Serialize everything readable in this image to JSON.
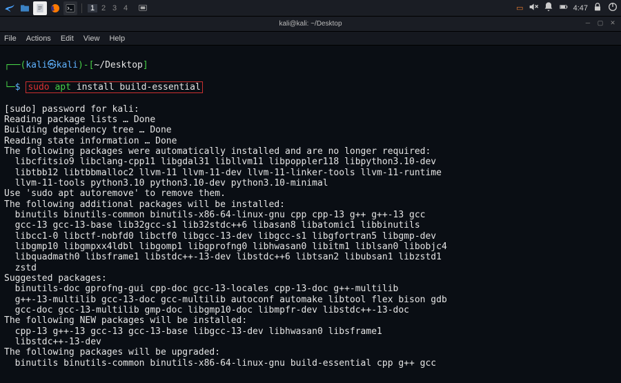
{
  "taskbar": {
    "workspaces": [
      "1",
      "2",
      "3",
      "4"
    ],
    "active_workspace": "1",
    "clock": "4:47"
  },
  "window": {
    "title": "kali@kali: ~/Desktop"
  },
  "menubar": {
    "file": "File",
    "actions": "Actions",
    "edit": "Edit",
    "view": "View",
    "help": "Help"
  },
  "prompt": {
    "open": "┌──(",
    "userhost": "kali㉿kali",
    "close_user": ")-[",
    "cwd": "~/Desktop",
    "close_cwd": "]",
    "line2_prefix": "└─",
    "dollar": "$ ",
    "cmd_sudo": "sudo",
    "cmd_apt": "apt",
    "cmd_rest": "install build-essential"
  },
  "lines": [
    "[sudo] password for kali:",
    "Reading package lists … Done ",
    "Building dependency tree … Done",
    "Reading state information … Done",
    "The following packages were automatically installed and are no longer required:",
    "  libcfitsio9 libclang-cpp11 libgdal31 libllvm11 libpoppler118 libpython3.10-dev",
    "  libtbb12 libtbbmalloc2 llvm-11 llvm-11-dev llvm-11-linker-tools llvm-11-runtime",
    "  llvm-11-tools python3.10 python3.10-dev python3.10-minimal",
    "Use 'sudo apt autoremove' to remove them.",
    "The following additional packages will be installed:",
    "  binutils binutils-common binutils-x86-64-linux-gnu cpp cpp-13 g++ g++-13 gcc",
    "  gcc-13 gcc-13-base lib32gcc-s1 lib32stdc++6 libasan8 libatomic1 libbinutils",
    "  libcc1-0 libctf-nobfd0 libctf0 libgcc-13-dev libgcc-s1 libgfortran5 libgmp-dev",
    "  libgmp10 libgmpxx4ldbl libgomp1 libgprofng0 libhwasan0 libitm1 liblsan0 libobjc4",
    "  libquadmath0 libsframe1 libstdc++-13-dev libstdc++6 libtsan2 libubsan1 libzstd1",
    "  zstd",
    "Suggested packages:",
    "  binutils-doc gprofng-gui cpp-doc gcc-13-locales cpp-13-doc g++-multilib",
    "  g++-13-multilib gcc-13-doc gcc-multilib autoconf automake libtool flex bison gdb",
    "  gcc-doc gcc-13-multilib gmp-doc libgmp10-doc libmpfr-dev libstdc++-13-doc",
    "The following NEW packages will be installed:",
    "  cpp-13 g++-13 gcc-13 gcc-13-base libgcc-13-dev libhwasan0 libsframe1",
    "  libstdc++-13-dev",
    "The following packages will be upgraded:",
    "  binutils binutils-common binutils-x86-64-linux-gnu build-essential cpp g++ gcc"
  ]
}
